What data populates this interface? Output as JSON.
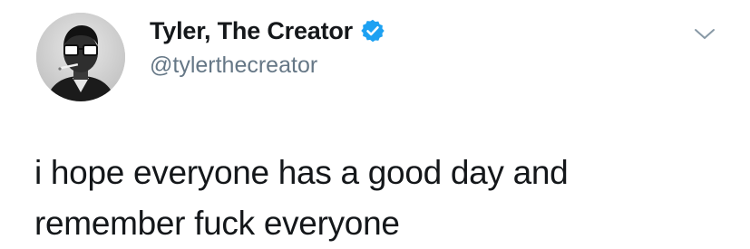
{
  "author": {
    "display_name": "Tyler, The Creator",
    "handle": "@tylerthecreator",
    "verified": true,
    "avatar_icon": "profile-photo",
    "verified_icon": "verified-badge-icon",
    "verified_color": "#1da1f2"
  },
  "menu": {
    "icon": "chevron-down-icon"
  },
  "tweet": {
    "text_lines": [
      "i hope everyone has a good day and",
      "remember fuck everyone"
    ]
  },
  "colors": {
    "name": "#14171a",
    "handle": "#657786",
    "caret": "#8899a6"
  }
}
